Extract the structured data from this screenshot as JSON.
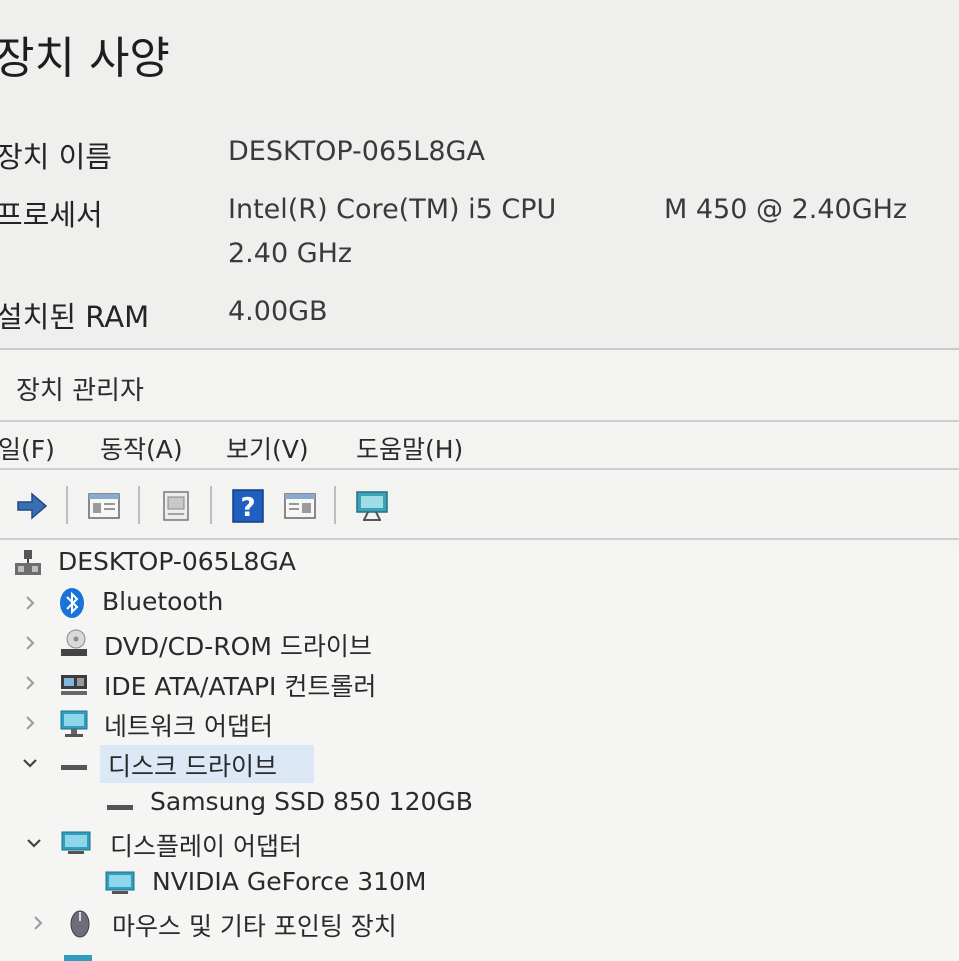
{
  "spec": {
    "title": "장치 사양",
    "rows": [
      {
        "label": "장치 이름",
        "value": "DESKTOP-065L8GA"
      },
      {
        "label": "프로세서",
        "value": "Intel(R) Core(TM) i5 CPU",
        "value2": "M 450  @ 2.40GHz",
        "value3": "2.40 GHz"
      },
      {
        "label": "설치된 RAM",
        "value": "4.00GB"
      }
    ]
  },
  "device_manager": {
    "title": "장치 관리자",
    "menu": [
      "일(F)",
      "동작(A)",
      "보기(V)",
      "도움말(H)"
    ],
    "toolbar": [
      "forward-arrow-icon",
      "properties-icon",
      "device-icon",
      "help-icon",
      "driver-icon",
      "monitor-icon"
    ],
    "tree": {
      "root": "DESKTOP-065L8GA",
      "items": [
        {
          "label": "Bluetooth",
          "expanded": false,
          "icon": "bluetooth-icon"
        },
        {
          "label": "DVD/CD-ROM 드라이브",
          "expanded": false,
          "icon": "optical-drive-icon"
        },
        {
          "label": "IDE ATA/ATAPI 컨트롤러",
          "expanded": false,
          "icon": "controller-icon"
        },
        {
          "label": "네트워크 어댑터",
          "expanded": false,
          "icon": "network-icon"
        },
        {
          "label": "디스크 드라이브",
          "expanded": true,
          "selected": true,
          "icon": "disk-drive-icon",
          "children": [
            "Samsung SSD 850 120GB"
          ]
        },
        {
          "label": "디스플레이 어댑터",
          "expanded": true,
          "icon": "display-adapter-icon",
          "children": [
            "NVIDIA GeForce 310M"
          ]
        },
        {
          "label": "마우스 및 기타 포인팅 장치",
          "expanded": false,
          "icon": "mouse-icon"
        }
      ]
    }
  },
  "colors": {
    "selection": "#dce8f6",
    "bluetooth": "#1a73d9",
    "help_icon": "#1f5fbf"
  }
}
